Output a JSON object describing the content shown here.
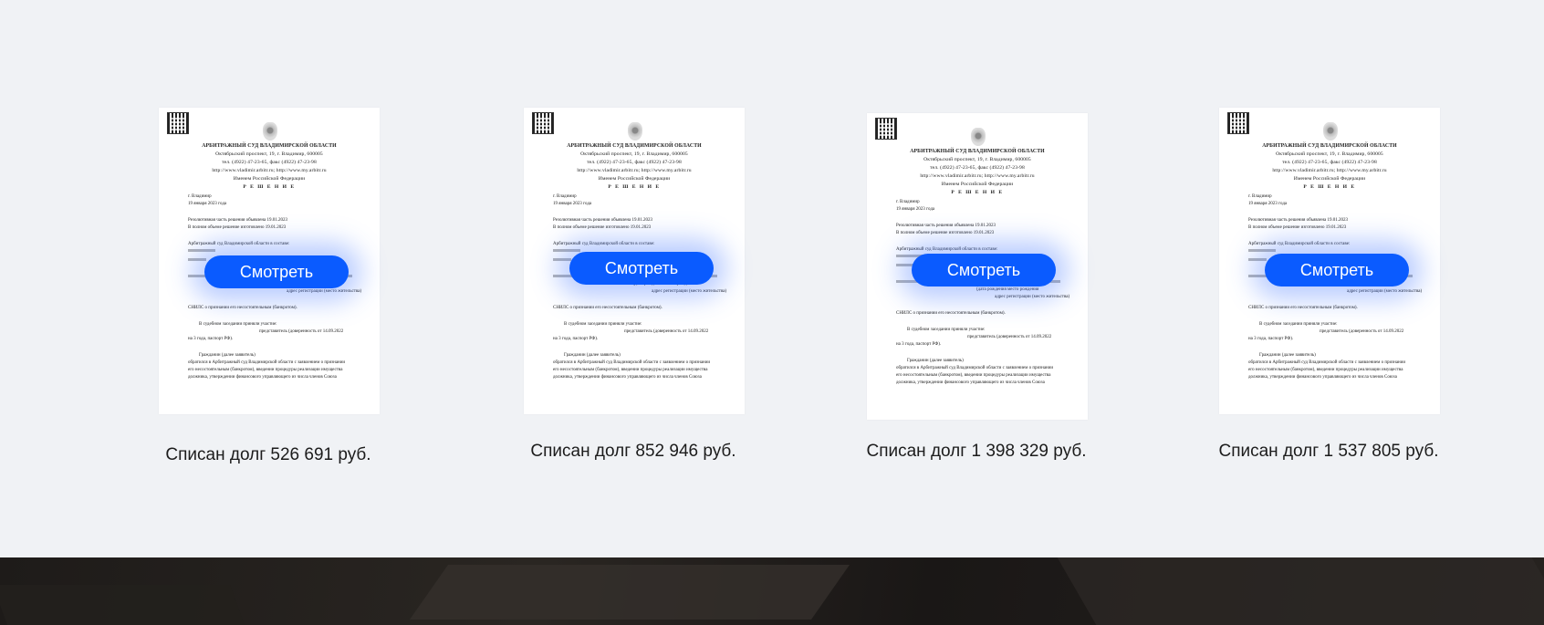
{
  "cards": [
    {
      "button_label": "Смотреть",
      "caption": "Списан долг 526 691 руб."
    },
    {
      "button_label": "Смотреть",
      "caption": "Списан долг 852 946 руб."
    },
    {
      "button_label": "Смотреть",
      "caption": "Списан долг 1 398 329 руб."
    },
    {
      "button_label": "Смотреть",
      "caption": "Списан долг 1 537 805 руб."
    }
  ],
  "document": {
    "court": "АРБИТРАЖНЫЙ СУД ВЛАДИМИРСКОЙ ОБЛАСТИ",
    "address": "Октябрьский проспект, 19, г. Владимир, 600005",
    "phone": "тел. (4922) 47-23-65, факс (4922) 47-23-98",
    "site": "http://www.vladimir.arbitr.ru; http://www.my.arbitr.ru",
    "name_of": "Именем Российской Федерации",
    "decision": "Р Е Ш Е Н И Е",
    "city": "г. Владимир",
    "date": "19 января 2023 года",
    "line1": "Резолютивная часть решения объявлена 19.01.2023",
    "line2": "В полном объеме решение изготовлено 19.01.2023",
    "line3": "Арбитражный суд Владимирской области в составе:",
    "line4": "(дата рождения                     место рождения",
    "line5": "адрес регистрации (место жительства)",
    "line6": "СНИЛС                  о признании его несостоятельным (банкротом).",
    "line7": "В судебном заседании приняли участие:",
    "line8": "представитель (доверенность от 14.09.2022",
    "line9": "на 3 года, паспорт РФ).",
    "line10": "Гражданин                              (далее          заявитель)",
    "line11": "обратился в Арбитражный суд Владимирской области с заявлением о признании",
    "line12": "его несостоятельным (банкротом), введении процедуры реализации имущества",
    "line13": "должника, утверждении финансового управляющего из числа членов Союза"
  },
  "colors": {
    "button": "#0a5bff",
    "background": "#f0f2f5",
    "footer": "#1e1b19"
  }
}
